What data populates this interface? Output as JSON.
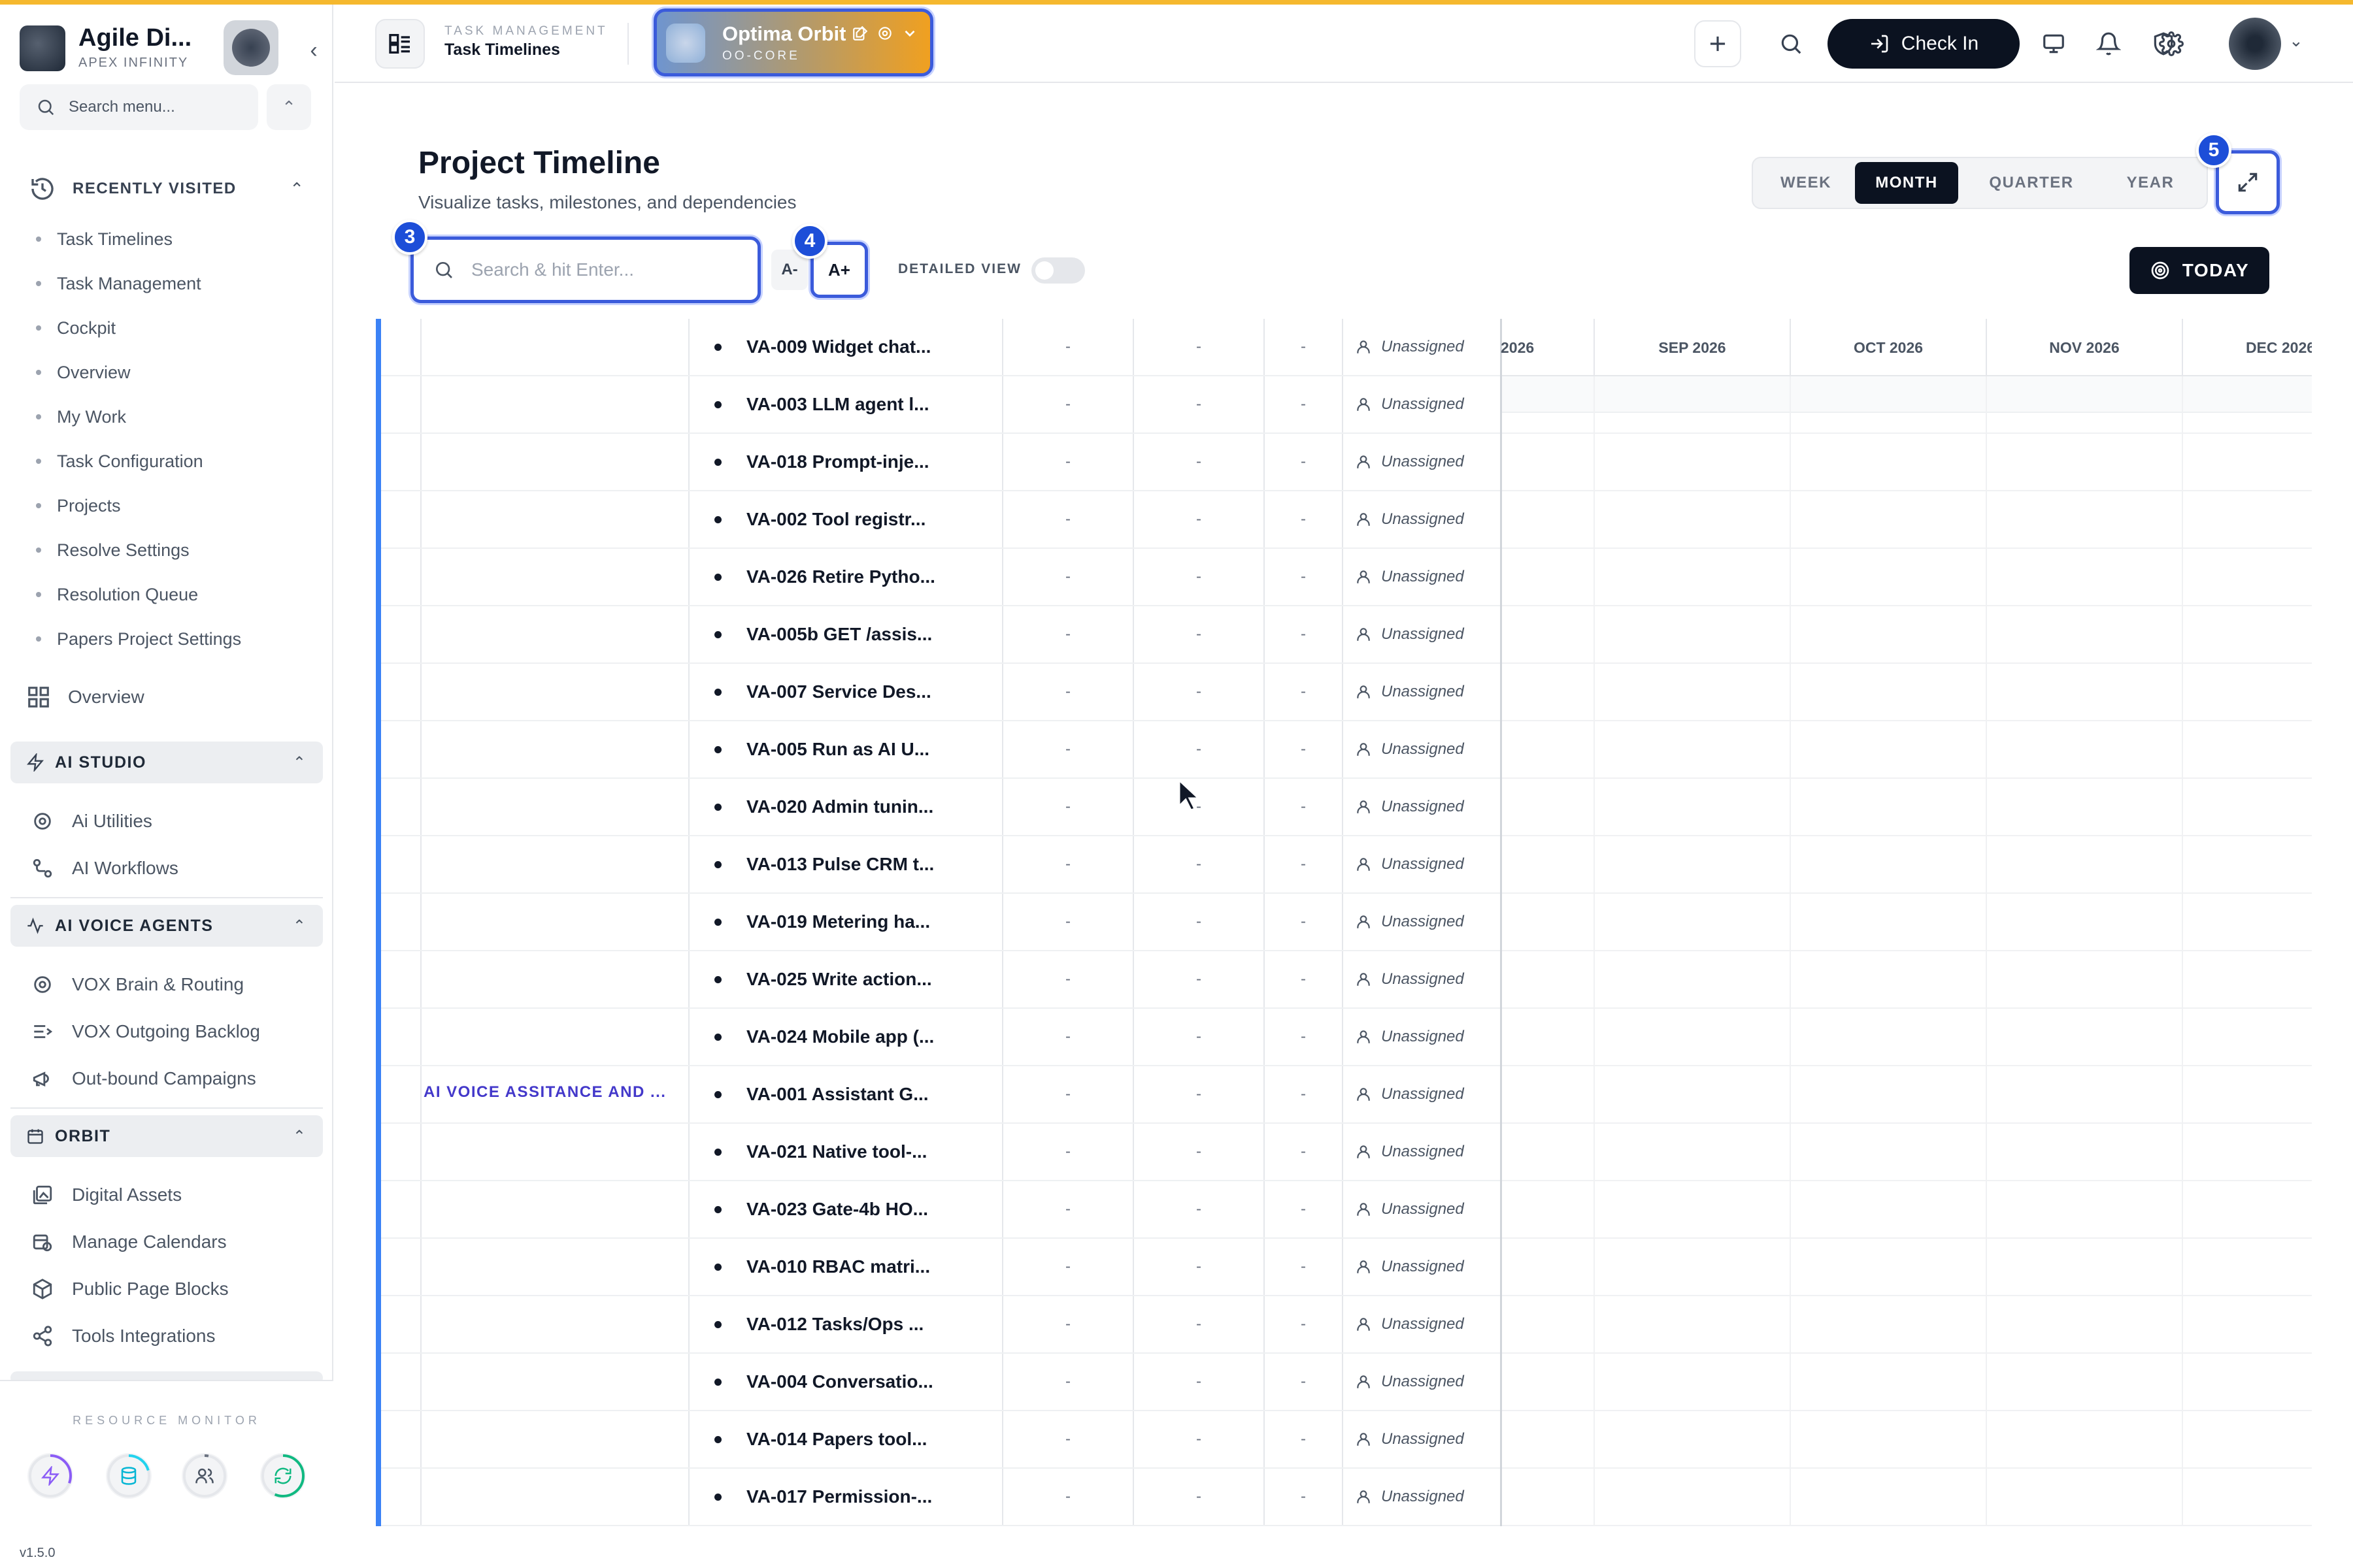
{
  "brand": {
    "name": "Agile Di...",
    "subtitle": "APEX INFINITY"
  },
  "sidebar": {
    "search_placeholder": "Search menu...",
    "recently_visited": {
      "title": "RECENTLY VISITED",
      "items": [
        "Task Timelines",
        "Task Management",
        "Cockpit",
        "Overview",
        "My Work",
        "Task Configuration",
        "Projects",
        "Resolve Settings",
        "Resolution Queue",
        "Papers Project Settings"
      ]
    },
    "overview_label": "Overview",
    "sections": [
      {
        "title": "AI STUDIO",
        "items": [
          {
            "label": "Ai Utilities",
            "icon": "gear-icon"
          },
          {
            "label": "AI Workflows",
            "icon": "workflow-icon"
          }
        ]
      },
      {
        "title": "AI VOICE AGENTS",
        "items": [
          {
            "label": "VOX Brain & Routing",
            "icon": "gear-icon"
          },
          {
            "label": "VOX Outgoing Backlog",
            "icon": "list-arrow-icon"
          },
          {
            "label": "Out-bound Campaigns",
            "icon": "megaphone-icon"
          }
        ]
      },
      {
        "title": "ORBIT",
        "items": [
          {
            "label": "Digital Assets",
            "icon": "images-icon"
          },
          {
            "label": "Manage Calendars",
            "icon": "calendar-icon"
          },
          {
            "label": "Public Page Blocks",
            "icon": "cube-icon"
          },
          {
            "label": "Tools Integrations",
            "icon": "share-icon"
          }
        ]
      }
    ],
    "resource_monitor_label": "RESOURCE MONITOR",
    "version": "v1.5.0"
  },
  "topbar": {
    "crumb_top": "TASK MANAGEMENT",
    "crumb_title": "Task Timelines",
    "workspace": {
      "name": "Optima Orbit",
      "code": "OO-CORE"
    },
    "checkin_label": "Check In"
  },
  "header": {
    "title": "Project Timeline",
    "subtitle": "Visualize tasks, milestones, and dependencies",
    "view_tabs": [
      "WEEK",
      "MONTH",
      "QUARTER",
      "YEAR"
    ],
    "active_view": "MONTH",
    "search_placeholder": "Search & hit Enter...",
    "font_decrease": "A-",
    "font_increase": "A+",
    "detailed_view_label": "DETAILED VIEW",
    "today_label": "TODAY",
    "badges": [
      "3",
      "4",
      "5"
    ]
  },
  "timeline": {
    "group_label": "AI VOICE ASSITANCE AND ...",
    "months": [
      "2026",
      "SEP 2026",
      "OCT 2026",
      "NOV 2026",
      "DEC 2026"
    ],
    "tasks": [
      {
        "name": "VA-009 Widget chat...",
        "c1": "-",
        "c2": "-",
        "c3": "-",
        "assignee": "Unassigned"
      },
      {
        "name": "VA-003 LLM agent l...",
        "c1": "-",
        "c2": "-",
        "c3": "-",
        "assignee": "Unassigned"
      },
      {
        "name": "VA-018 Prompt-inje...",
        "c1": "-",
        "c2": "-",
        "c3": "-",
        "assignee": "Unassigned"
      },
      {
        "name": "VA-002 Tool registr...",
        "c1": "-",
        "c2": "-",
        "c3": "-",
        "assignee": "Unassigned"
      },
      {
        "name": "VA-026 Retire Pytho...",
        "c1": "-",
        "c2": "-",
        "c3": "-",
        "assignee": "Unassigned"
      },
      {
        "name": "VA-005b GET /assis...",
        "c1": "-",
        "c2": "-",
        "c3": "-",
        "assignee": "Unassigned"
      },
      {
        "name": "VA-007 Service Des...",
        "c1": "-",
        "c2": "-",
        "c3": "-",
        "assignee": "Unassigned"
      },
      {
        "name": "VA-005 Run as AI U...",
        "c1": "-",
        "c2": "-",
        "c3": "-",
        "assignee": "Unassigned"
      },
      {
        "name": "VA-020 Admin tunin...",
        "c1": "-",
        "c2": "-",
        "c3": "-",
        "assignee": "Unassigned"
      },
      {
        "name": "VA-013 Pulse CRM t...",
        "c1": "-",
        "c2": "-",
        "c3": "-",
        "assignee": "Unassigned"
      },
      {
        "name": "VA-019 Metering ha...",
        "c1": "-",
        "c2": "-",
        "c3": "-",
        "assignee": "Unassigned"
      },
      {
        "name": "VA-025 Write action...",
        "c1": "-",
        "c2": "-",
        "c3": "-",
        "assignee": "Unassigned"
      },
      {
        "name": "VA-024 Mobile app (...",
        "c1": "-",
        "c2": "-",
        "c3": "-",
        "assignee": "Unassigned"
      },
      {
        "name": "VA-001 Assistant G...",
        "c1": "-",
        "c2": "-",
        "c3": "-",
        "assignee": "Unassigned"
      },
      {
        "name": "VA-021 Native tool-...",
        "c1": "-",
        "c2": "-",
        "c3": "-",
        "assignee": "Unassigned"
      },
      {
        "name": "VA-023 Gate-4b HO...",
        "c1": "-",
        "c2": "-",
        "c3": "-",
        "assignee": "Unassigned"
      },
      {
        "name": "VA-010 RBAC matri...",
        "c1": "-",
        "c2": "-",
        "c3": "-",
        "assignee": "Unassigned"
      },
      {
        "name": "VA-012 Tasks/Ops ...",
        "c1": "-",
        "c2": "-",
        "c3": "-",
        "assignee": "Unassigned"
      },
      {
        "name": "VA-004 Conversatio...",
        "c1": "-",
        "c2": "-",
        "c3": "-",
        "assignee": "Unassigned"
      },
      {
        "name": "VA-014 Papers tool...",
        "c1": "-",
        "c2": "-",
        "c3": "-",
        "assignee": "Unassigned"
      },
      {
        "name": "VA-017 Permission-...",
        "c1": "-",
        "c2": "-",
        "c3": "-",
        "assignee": "Unassigned"
      }
    ]
  },
  "colors": {
    "accent": "#3b5bdb",
    "dark": "#0b1220",
    "group_label": "#4338ca",
    "top_line": "#f5b82e"
  }
}
